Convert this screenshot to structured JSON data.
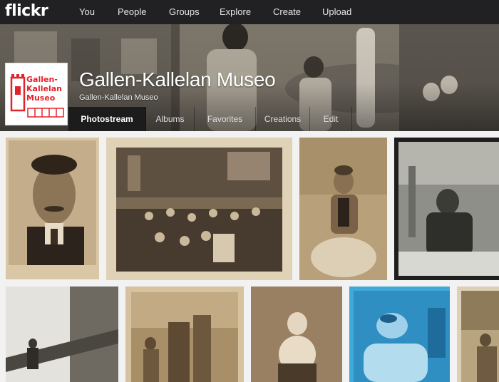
{
  "brand": {
    "name": "flickr"
  },
  "nav": {
    "items": [
      {
        "label": "You"
      },
      {
        "label": "People"
      },
      {
        "label": "Groups"
      },
      {
        "label": "Explore"
      },
      {
        "label": "Create"
      },
      {
        "label": "Upload"
      }
    ]
  },
  "profile": {
    "title": "Gallen-Kallelan Museo",
    "subtitle": "Gallen-Kallelan Museo",
    "avatar_logo": {
      "lines": [
        "Gallen-",
        "Kallelan",
        "Museo"
      ],
      "color": "#e0242b"
    }
  },
  "tabs": [
    {
      "label": "Photostream",
      "active": true
    },
    {
      "label": "Albums",
      "active": false
    },
    {
      "label": "Favorites",
      "active": false
    },
    {
      "label": "Creations",
      "active": false
    },
    {
      "label": "Edit",
      "active": false
    }
  ],
  "colors": {
    "nav_background": "#212124",
    "grid_background": "#f2f2f2",
    "sepia_dark": "#3a2e22",
    "sepia_light": "#d9c7a6",
    "cyanotype": "#3fa9d8"
  },
  "photos": [
    {
      "name": "portrait-man-mustache",
      "tone": "sepia"
    },
    {
      "name": "studio-group-photo",
      "tone": "sepia"
    },
    {
      "name": "seated-woman-portrait",
      "tone": "sepia"
    },
    {
      "name": "man-working-negative",
      "tone": "gray"
    },
    {
      "name": "workers-on-beam",
      "tone": "gray"
    },
    {
      "name": "figures-outdoors",
      "tone": "sepia"
    },
    {
      "name": "child-on-chair",
      "tone": "sepia"
    },
    {
      "name": "cyanotype-man-looking-up",
      "tone": "cyan"
    },
    {
      "name": "seated-man-outdoors",
      "tone": "sepia"
    }
  ]
}
